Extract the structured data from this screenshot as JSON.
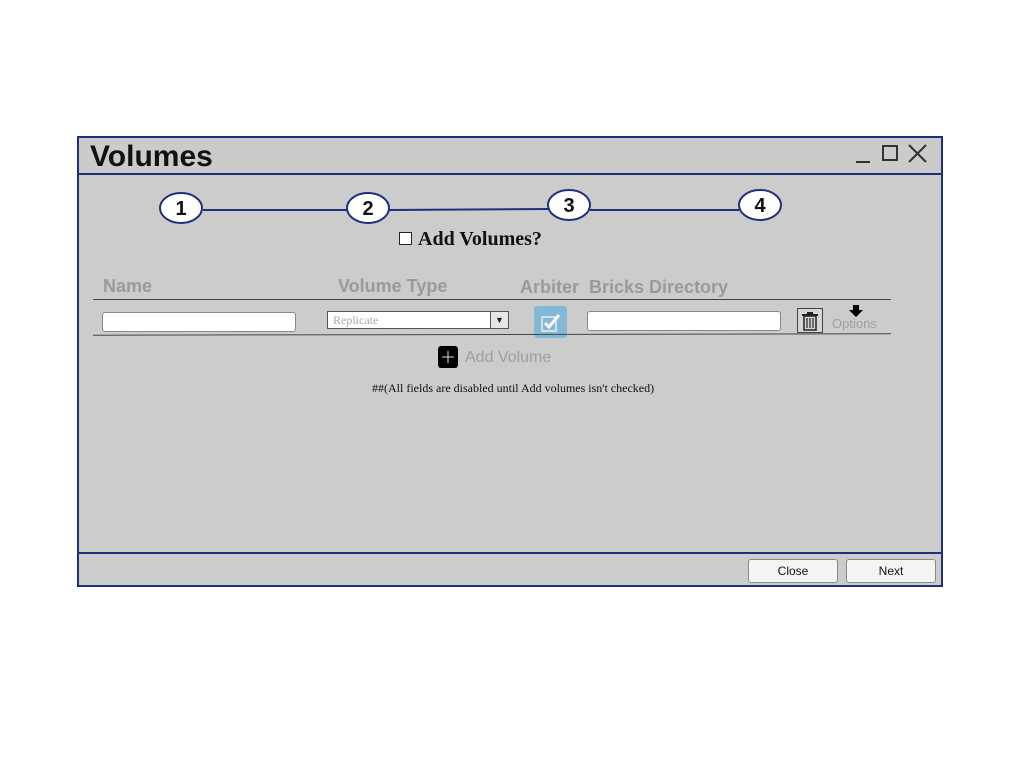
{
  "window": {
    "title": "Volumes",
    "controls": [
      "minimize-icon",
      "maximize-icon",
      "close-icon"
    ]
  },
  "wizard": {
    "steps": [
      "1",
      "2",
      "3",
      "4"
    ]
  },
  "add_volumes": {
    "label": "Add Volumes?",
    "checked": false
  },
  "table": {
    "headers": {
      "name": "Name",
      "volume_type": "Volume Type",
      "arbiter": "Arbiter",
      "bricks_directory": "Bricks Directory"
    },
    "row": {
      "name_value": "",
      "volume_type_value": "Replicate",
      "arbiter_checked": true,
      "bricks_directory_value": "",
      "delete_icon": "trash-icon",
      "options_label": "Options"
    }
  },
  "add_volume_button": {
    "label": "Add Volume",
    "icon": "plus-icon"
  },
  "note": "##(All fields are disabled until Add volumes isn't checked)",
  "footer": {
    "close_label": "Close",
    "next_label": "Next"
  },
  "colors": {
    "window_border": "#1f2f7a",
    "background": "#cccccc",
    "disabled_text": "#9a9a9a",
    "arbiter_accent": "#7db8d6"
  }
}
